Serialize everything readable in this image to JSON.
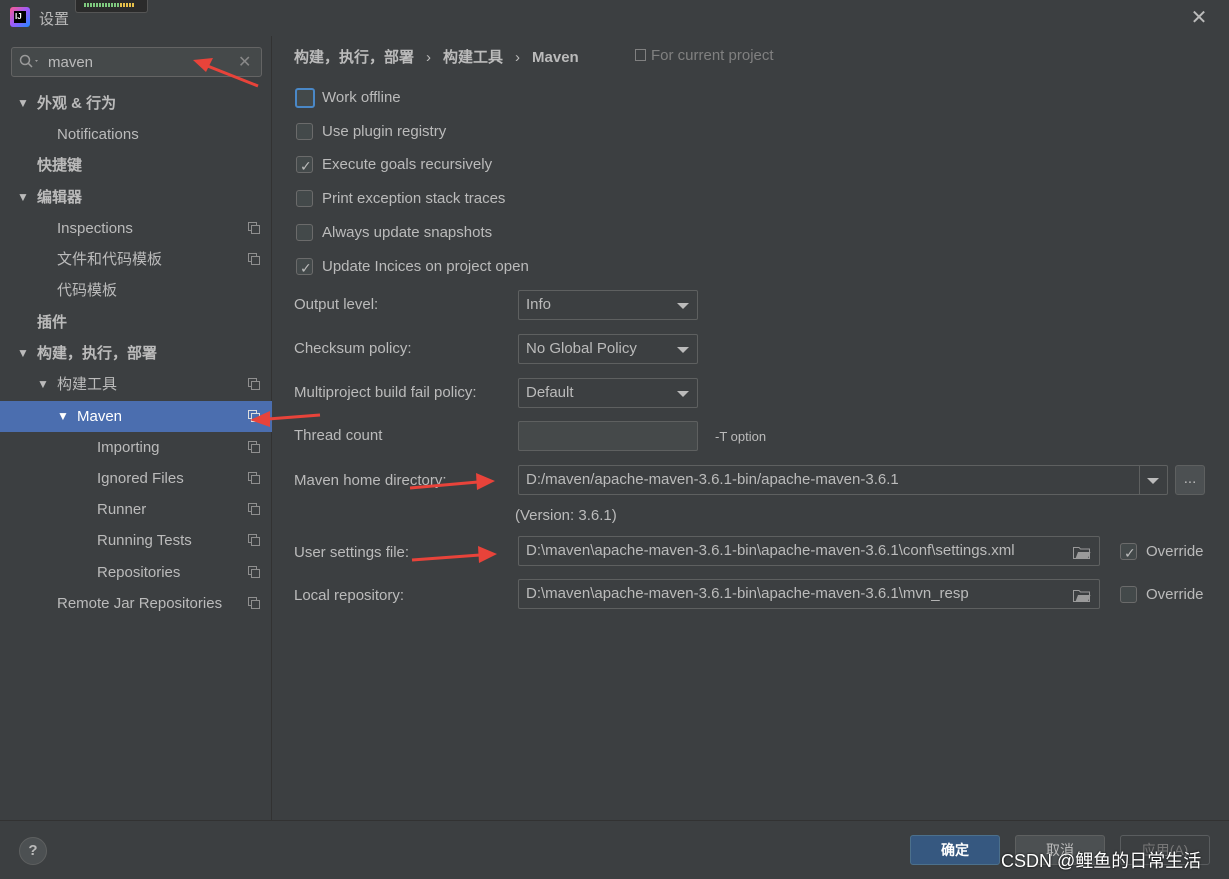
{
  "window": {
    "title": "设置",
    "close_glyph": "✕"
  },
  "search": {
    "value": "maven",
    "clear_glyph": "✕"
  },
  "sidebar": {
    "items": [
      {
        "label": "外观 & 行为",
        "expanded": true,
        "bold": true
      },
      {
        "label": "Notifications"
      },
      {
        "label": "快捷键",
        "bold": true
      },
      {
        "label": "编辑器",
        "expanded": true,
        "bold": true
      },
      {
        "label": "Inspections",
        "project_icon": true
      },
      {
        "label": "文件和代码模板",
        "project_icon": true
      },
      {
        "label": "代码模板"
      },
      {
        "label": "插件",
        "bold": true
      },
      {
        "label": "构建，执行，部署",
        "expanded": true,
        "bold": true
      },
      {
        "label": "构建工具",
        "expanded": true,
        "project_icon": true
      },
      {
        "label": "Maven",
        "expanded": true,
        "selected": true,
        "project_icon": true
      },
      {
        "label": "Importing",
        "project_icon": true
      },
      {
        "label": "Ignored Files",
        "project_icon": true
      },
      {
        "label": "Runner",
        "project_icon": true
      },
      {
        "label": "Running Tests",
        "project_icon": true
      },
      {
        "label": "Repositories",
        "project_icon": true
      },
      {
        "label": "Remote Jar Repositories",
        "project_icon": true
      }
    ],
    "arrow_glyph": "▼"
  },
  "breadcrumb": {
    "items": [
      "构建，执行，部署",
      "构建工具",
      "Maven"
    ],
    "separator": "›",
    "for_project": "For current project"
  },
  "options": {
    "work_offline": {
      "label": "Work offline",
      "checked": false
    },
    "use_plugin_registry": {
      "label": "Use plugin registry",
      "checked": false
    },
    "execute_goals_recursively": {
      "label": "Execute goals recursively",
      "checked": true
    },
    "print_exception_stack_traces": {
      "label": "Print exception stack traces",
      "checked": false
    },
    "always_update_snapshots": {
      "label": "Always update snapshots",
      "checked": false
    },
    "update_indices": {
      "label": "Update Incices on project open",
      "checked": true
    },
    "check_glyph": "✓"
  },
  "form": {
    "output_level": {
      "label": "Output level:",
      "value": "Info"
    },
    "checksum_policy": {
      "label": "Checksum policy:",
      "value": "No Global Policy"
    },
    "multiproject_fail_policy": {
      "label": "Multiproject build fail policy:",
      "value": "Default"
    },
    "thread_count": {
      "label": "Thread count",
      "value": "",
      "hint": "-T option"
    },
    "maven_home": {
      "label": "Maven home directory:",
      "value": "D:/maven/apache-maven-3.6.1-bin/apache-maven-3.6.1",
      "browse": "...",
      "version": "(Version: 3.6.1)"
    },
    "user_settings": {
      "label": "User settings file:",
      "value": "D:\\maven\\apache-maven-3.6.1-bin\\apache-maven-3.6.1\\conf\\settings.xml",
      "override_label": "Override",
      "override_checked": true
    },
    "local_repository": {
      "label": "Local repository:",
      "value": "D:\\maven\\apache-maven-3.6.1-bin\\apache-maven-3.6.1\\mvn_resp",
      "override_label": "Override",
      "override_checked": false
    }
  },
  "footer": {
    "help": "?",
    "ok": "确定",
    "cancel": "取消",
    "apply": "应用(A)",
    "watermark": "CSDN @鲤鱼的日常生活"
  },
  "colors": {
    "background": "#3c3f41",
    "selection": "#4b6eaf",
    "primary_button": "#365880",
    "annotation_arrow": "#e8433a"
  }
}
